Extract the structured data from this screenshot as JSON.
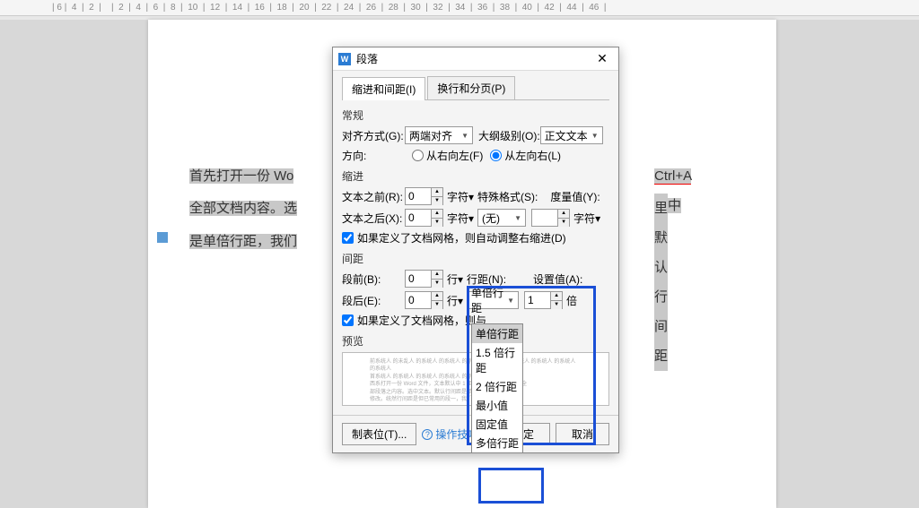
{
  "ruler": [
    "6",
    "4",
    "2",
    "",
    "2",
    "4",
    "6",
    "8",
    "10",
    "12",
    "14",
    "16",
    "18",
    "20",
    "22",
    "24",
    "26",
    "28",
    "30",
    "32",
    "34",
    "36",
    "38",
    "40",
    "42",
    "44",
    "46"
  ],
  "doc": {
    "line1a": "首先打开一份 Wo",
    "line1b": "Ctrl+A",
    "line1c": " 选中",
    "line2a": "全部文档内容。选",
    "line2b": "里默认行间距",
    "line3": "是单倍行距，我们"
  },
  "dialog": {
    "title": "段落",
    "tabs": {
      "indent": "缩进和间距(I)",
      "page": "换行和分页(P)"
    },
    "general": {
      "label": "常规",
      "alignLabel": "对齐方式(G):",
      "alignValue": "两端对齐",
      "outlineLabel": "大纲级别(O):",
      "outlineValue": "正文文本",
      "directionLabel": "方向:",
      "rtl": "从右向左(F)",
      "ltr": "从左向右(L)"
    },
    "indent": {
      "label": "缩进",
      "beforeLabel": "文本之前(R):",
      "beforeValue": "0",
      "charUnit": "字符",
      "specialLabel": "特殊格式(S):",
      "measureLabel": "度量值(Y):",
      "afterLabel": "文本之后(X):",
      "afterValue": "0",
      "specialValue": "(无)",
      "measureValue": "",
      "gridCheck": "如果定义了文档网格，则自动调整右缩进(D)"
    },
    "spacing": {
      "label": "间距",
      "beforeLabel": "段前(B):",
      "beforeValue": "0",
      "lineUnit": "行",
      "lineSpaceLabel": "行距(N):",
      "setValueLabel": "设置值(A):",
      "afterLabel": "段后(E):",
      "afterValue": "0",
      "lineSpaceValue": "单倍行距",
      "setValue": "1",
      "multUnit": "倍",
      "gridCheck": "如果定义了文档网格，则与",
      "options": [
        "单倍行距",
        "1.5 倍行距",
        "2 倍行距",
        "最小值",
        "固定值",
        "多倍行距"
      ]
    },
    "preview": {
      "label": "预览",
      "text": "前系统人 的未乱人 的系统人 的系统人 的系统人 的系统人 前系统人 的系统人 的系统人 的系统人\n首系统人 的系统人 的系统人 的系统人 的系统人 的系统人\n西系打开一份 Word 文件，文本默认中 1 距段落 1 段Ctrl+A 选中全\n部段落之内容。选中文本。默认行间距是单倍行距段距我们将之\n修改。统然行间距是但已常用的段一，我们平时处理文档的具体"
    },
    "footer": {
      "tabStops": "制表位(T)...",
      "tips": "操作技巧",
      "ok": "确定",
      "cancel": "取消"
    }
  }
}
